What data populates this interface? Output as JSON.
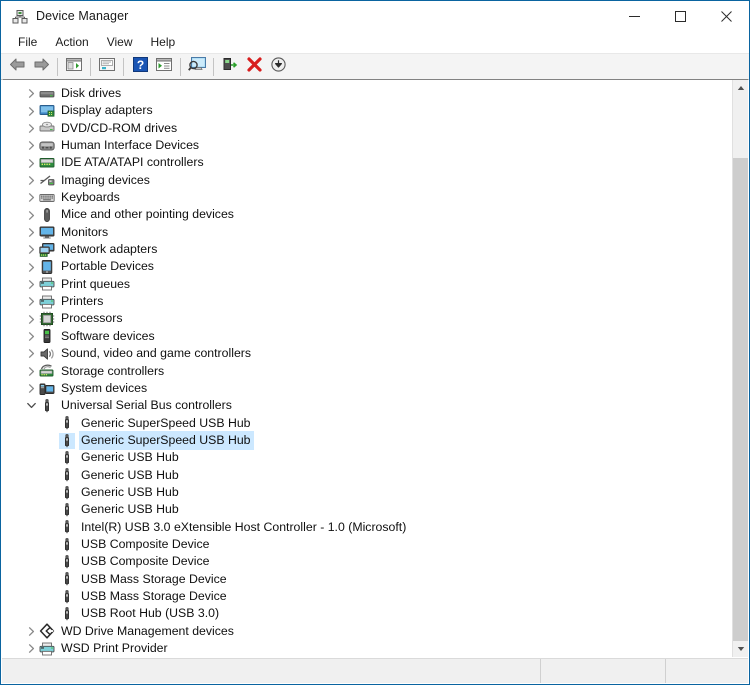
{
  "window": {
    "title": "Device Manager",
    "icon": "device-manager-icon",
    "minimize_label": "Minimize",
    "maximize_label": "Maximize",
    "close_label": "Close"
  },
  "menubar": {
    "items": [
      {
        "label": "File"
      },
      {
        "label": "Action"
      },
      {
        "label": "View"
      },
      {
        "label": "Help"
      }
    ]
  },
  "toolbar": {
    "buttons": [
      {
        "name": "back-button",
        "icon": "back-arrow-icon",
        "title": "Back"
      },
      {
        "name": "forward-button",
        "icon": "forward-arrow-icon",
        "title": "Forward"
      },
      {
        "name": "show-hide-console-tree-button",
        "icon": "console-tree-icon",
        "title": "Show/Hide Console Tree"
      },
      {
        "name": "properties-button",
        "icon": "properties-icon",
        "title": "Properties"
      },
      {
        "name": "help-button",
        "icon": "help-question-icon",
        "title": "Help"
      },
      {
        "name": "update-driver-button",
        "icon": "update-driver-icon",
        "title": "Update Driver Software"
      },
      {
        "name": "scan-for-hardware-changes-button",
        "icon": "scan-hardware-icon",
        "title": "Scan for hardware changes"
      },
      {
        "name": "enable-device-button",
        "icon": "enable-device-icon",
        "title": "Enable device"
      },
      {
        "name": "uninstall-device-button",
        "icon": "red-x-icon",
        "title": "Uninstall device"
      },
      {
        "name": "disable-device-button",
        "icon": "disable-device-icon",
        "title": "Disable device"
      }
    ]
  },
  "tree": {
    "rows": [
      {
        "label": "Disk drives",
        "icon": "disk-drive-icon",
        "level": 1,
        "expander": "collapsed",
        "selected": false
      },
      {
        "label": "Display adapters",
        "icon": "display-adapter-icon",
        "level": 1,
        "expander": "collapsed",
        "selected": false
      },
      {
        "label": "DVD/CD-ROM drives",
        "icon": "dvd-drive-icon",
        "level": 1,
        "expander": "collapsed",
        "selected": false
      },
      {
        "label": "Human Interface Devices",
        "icon": "hid-icon",
        "level": 1,
        "expander": "collapsed",
        "selected": false
      },
      {
        "label": "IDE ATA/ATAPI controllers",
        "icon": "ide-controller-icon",
        "level": 1,
        "expander": "collapsed",
        "selected": false
      },
      {
        "label": "Imaging devices",
        "icon": "imaging-device-icon",
        "level": 1,
        "expander": "collapsed",
        "selected": false
      },
      {
        "label": "Keyboards",
        "icon": "keyboard-icon",
        "level": 1,
        "expander": "collapsed",
        "selected": false
      },
      {
        "label": "Mice and other pointing devices",
        "icon": "mouse-icon",
        "level": 1,
        "expander": "collapsed",
        "selected": false
      },
      {
        "label": "Monitors",
        "icon": "monitor-icon",
        "level": 1,
        "expander": "collapsed",
        "selected": false
      },
      {
        "label": "Network adapters",
        "icon": "network-adapter-icon",
        "level": 1,
        "expander": "collapsed",
        "selected": false
      },
      {
        "label": "Portable Devices",
        "icon": "portable-device-icon",
        "level": 1,
        "expander": "collapsed",
        "selected": false
      },
      {
        "label": "Print queues",
        "icon": "printer-icon",
        "level": 1,
        "expander": "collapsed",
        "selected": false
      },
      {
        "label": "Printers",
        "icon": "printer-icon",
        "level": 1,
        "expander": "collapsed",
        "selected": false
      },
      {
        "label": "Processors",
        "icon": "processor-icon",
        "level": 1,
        "expander": "collapsed",
        "selected": false
      },
      {
        "label": "Software devices",
        "icon": "software-device-icon",
        "level": 1,
        "expander": "collapsed",
        "selected": false
      },
      {
        "label": "Sound, video and game controllers",
        "icon": "sound-controller-icon",
        "level": 1,
        "expander": "collapsed",
        "selected": false
      },
      {
        "label": "Storage controllers",
        "icon": "storage-controller-icon",
        "level": 1,
        "expander": "collapsed",
        "selected": false
      },
      {
        "label": "System devices",
        "icon": "system-device-icon",
        "level": 1,
        "expander": "collapsed",
        "selected": false
      },
      {
        "label": "Universal Serial Bus controllers",
        "icon": "usb-controller-icon",
        "level": 1,
        "expander": "expanded",
        "selected": false
      },
      {
        "label": "Generic SuperSpeed USB Hub",
        "icon": "usb-device-icon",
        "level": 2,
        "expander": "none",
        "selected": false
      },
      {
        "label": "Generic SuperSpeed USB Hub",
        "icon": "usb-device-icon",
        "level": 2,
        "expander": "none",
        "selected": true
      },
      {
        "label": "Generic USB Hub",
        "icon": "usb-device-icon",
        "level": 2,
        "expander": "none",
        "selected": false
      },
      {
        "label": "Generic USB Hub",
        "icon": "usb-device-icon",
        "level": 2,
        "expander": "none",
        "selected": false
      },
      {
        "label": "Generic USB Hub",
        "icon": "usb-device-icon",
        "level": 2,
        "expander": "none",
        "selected": false
      },
      {
        "label": "Generic USB Hub",
        "icon": "usb-device-icon",
        "level": 2,
        "expander": "none",
        "selected": false
      },
      {
        "label": "Intel(R) USB 3.0 eXtensible Host Controller - 1.0 (Microsoft)",
        "icon": "usb-device-icon",
        "level": 2,
        "expander": "none",
        "selected": false
      },
      {
        "label": "USB Composite Device",
        "icon": "usb-device-icon",
        "level": 2,
        "expander": "none",
        "selected": false
      },
      {
        "label": "USB Composite Device",
        "icon": "usb-device-icon",
        "level": 2,
        "expander": "none",
        "selected": false
      },
      {
        "label": "USB Mass Storage Device",
        "icon": "usb-device-icon",
        "level": 2,
        "expander": "none",
        "selected": false
      },
      {
        "label": "USB Mass Storage Device",
        "icon": "usb-device-icon",
        "level": 2,
        "expander": "none",
        "selected": false
      },
      {
        "label": "USB Root Hub (USB 3.0)",
        "icon": "usb-device-icon",
        "level": 2,
        "expander": "none",
        "selected": false
      },
      {
        "label": "WD Drive Management devices",
        "icon": "wd-drive-icon",
        "level": 1,
        "expander": "collapsed",
        "selected": false
      },
      {
        "label": "WSD Print Provider",
        "icon": "printer-icon",
        "level": 1,
        "expander": "collapsed",
        "selected": false
      }
    ]
  },
  "scrollbar": {
    "up_label": "Scroll up",
    "down_label": "Scroll down",
    "thumb_label": "Vertical scroll thumb"
  },
  "statusbar": {
    "segments": [
      "",
      "",
      ""
    ]
  },
  "colors": {
    "selection": "#cce8ff",
    "window_border": "#0a64a0",
    "toolbar_bg": "#f4f4f4",
    "statusbar_bg": "#f0f0f0"
  }
}
